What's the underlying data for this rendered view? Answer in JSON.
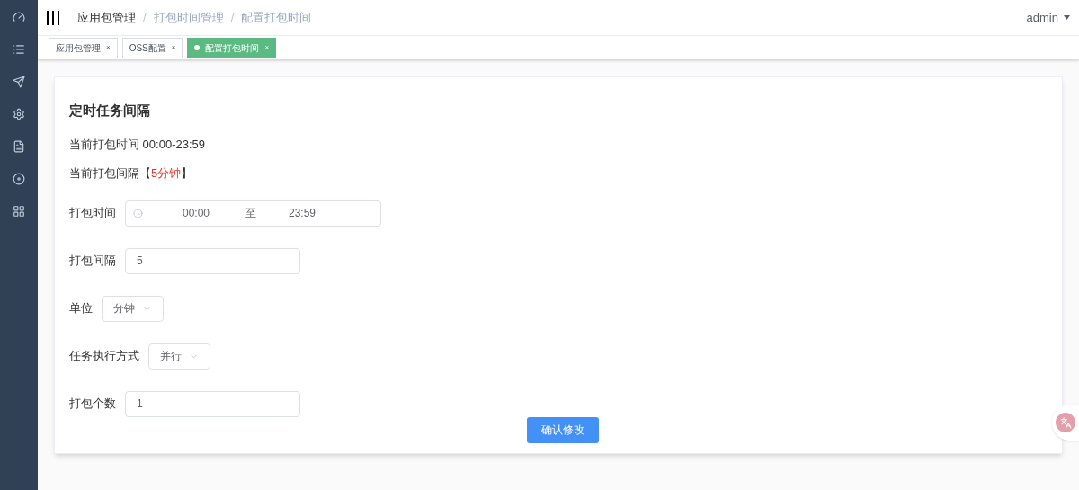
{
  "header": {
    "breadcrumb": [
      {
        "label": "应用包管理",
        "emphasized": true
      },
      {
        "label": "打包时间管理",
        "emphasized": false
      },
      {
        "label": "配置打包时间",
        "emphasized": false
      }
    ],
    "separator": "/",
    "user": "admin"
  },
  "tabs": [
    {
      "label": "应用包管理",
      "selected": false
    },
    {
      "label": "OSS配置",
      "selected": false
    },
    {
      "label": "配置打包时间",
      "selected": true
    }
  ],
  "tab_close": "×",
  "card": {
    "title": "定时任务间隔",
    "current_time": "当前打包时间 00:00-23:59",
    "current_interval": "当前打包间隔【**5分钟**】",
    "fields": [
      {
        "kind": "time-range",
        "label": "打包时间",
        "start": "00:00",
        "to": "至",
        "end": "23:59"
      },
      {
        "kind": "input",
        "label": "打包间隔",
        "value": "5"
      },
      {
        "kind": "select",
        "label": "单位",
        "value": "分钟"
      },
      {
        "kind": "select",
        "label": "任务执行方式",
        "value": "并行"
      },
      {
        "kind": "input",
        "label": "打包个数",
        "value": "1"
      }
    ],
    "submit": "确认修改"
  }
}
